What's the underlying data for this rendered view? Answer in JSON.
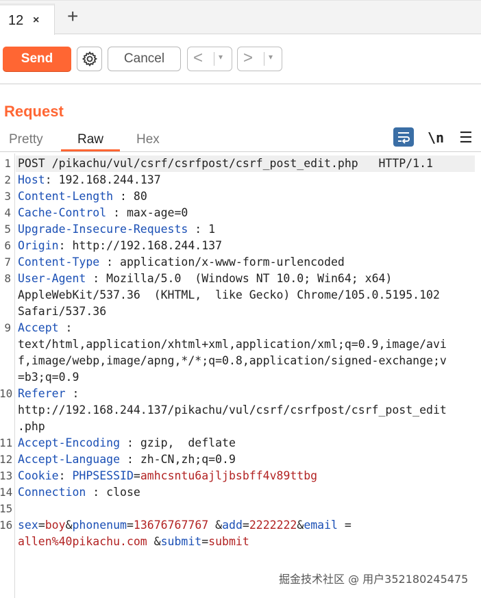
{
  "tabs": [
    {
      "label": "12",
      "close": "×"
    }
  ],
  "tab_add": "+",
  "toolbar": {
    "send_label": "Send",
    "cancel_label": "Cancel",
    "back_arrow": "<",
    "forward_arrow": ">",
    "dropdown_caret": "▾"
  },
  "request": {
    "title": "Request",
    "view_tabs": [
      "Pretty",
      "Raw",
      "Hex"
    ],
    "active_tab": "Raw",
    "newline_label": "\\n",
    "menu_label": "☰"
  },
  "line_numbers": [
    "1",
    "2",
    "3",
    "4",
    "5",
    "6",
    "7",
    "8",
    "9",
    "10",
    "11",
    "12",
    "13",
    "14",
    "15",
    "16"
  ],
  "lines": {
    "l1": "POST /pikachu/vul/csrf/csrfpost/csrf_post_edit.php   HTTP/1.1",
    "l2k": "Host",
    "l2v": ": 192.168.244.137",
    "l3k": "Content-Length",
    "l3v": " : 80",
    "l4k": "Cache-Control",
    "l4v": " : max-age=0",
    "l5k": "Upgrade-Insecure-Requests",
    "l5v": " : 1",
    "l6k": "Origin",
    "l6v": ": http://192.168.244.137",
    "l7k": "Content-Type",
    "l7v": " : application/x-www-form-urlencoded",
    "l8k": "User-Agent",
    "l8v": " : Mozilla/5.0  (Windows NT 10.0; Win64; x64)",
    "l8w1": "AppleWebKit/537.36  (KHTML,  like Gecko) Chrome/105.0.5195.102",
    "l8w2": "Safari/537.36",
    "l9k": "Accept",
    "l9v": " :",
    "l9w1": "text/html,application/xhtml+xml,application/xml;q=0.9,image/avi",
    "l9w2": "f,image/webp,image/apng,*/*;q=0.8,application/signed-exchange;v",
    "l9w3": "=b3;q=0.9",
    "l10k": "Referer",
    "l10v": " :",
    "l10w1": "http://192.168.244.137/pikachu/vul/csrf/csrfpost/csrf_post_edit",
    "l10w2": ".php",
    "l11k": "Accept-Encoding",
    "l11v": " : gzip,  deflate",
    "l12k": "Accept-Language",
    "l12v": " : zh-CN,zh;q=0.9",
    "l13k": "Cookie",
    "l13sep": ": ",
    "l13name": "PHPSESSID",
    "l13eq": "=",
    "l13val": "amhcsntu6ajljbsbff4v89ttbg",
    "l14k": "Connection",
    "l14v": " : close",
    "body": {
      "k1": "sex",
      "eq1": "=",
      "v1": "boy",
      "amp1": "&",
      "k2": "phonenum",
      "eq2": "=",
      "v2": "13676767767",
      "amp2": " &",
      "k3": "add",
      "eq3": "=",
      "v3": "2222222",
      "amp3": "&",
      "k4": "email",
      "eq4": " =",
      "v4": "allen%40pikachu.com",
      "amp4": " &",
      "k5": "submit",
      "eq5": "=",
      "v5": "submit"
    }
  },
  "watermark": "掘金技术社区 @ 用户352180245475",
  "colors": {
    "accent": "#ff6633",
    "header_key": "#1a4fb5",
    "value_red": "#b22222"
  }
}
